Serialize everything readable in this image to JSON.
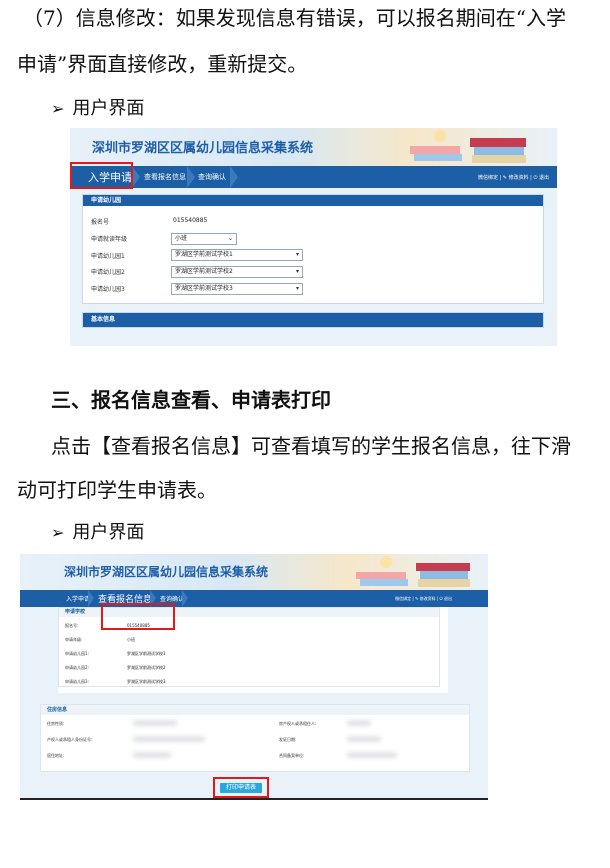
{
  "doc": {
    "item7": "（7）信息修改：如果发现信息有错误，可以报名期间在“入学",
    "item7_cont": "申请”界面直接修改，重新提交。",
    "bullet_label": "用户界面",
    "section3": "三、报名信息查看、申请表打印",
    "para1": "点击【查看报名信息】可查看填写的学生报名信息，往下滑",
    "para1_cont": "动可打印学生申请表。",
    "bullet_label2": "用户界面"
  },
  "shot1": {
    "system_title": "深圳市罗湖区区属幼儿园信息采集系统",
    "nav": {
      "tab1": "入学申请",
      "tab2": "查看报名信息",
      "tab3": "查询确认",
      "right": "微信绑定 | ✎ 修改资料 | ⏻ 退出"
    },
    "panel1_title": "申请幼儿园",
    "fields": [
      {
        "label": "报名号",
        "value": "015540885"
      },
      {
        "label": "申请就读年级",
        "value": "小班"
      },
      {
        "label": "申请幼儿园1",
        "value": "罗湖区学前测试学校1"
      },
      {
        "label": "申请幼儿园2",
        "value": "罗湖区学前测试学校2"
      },
      {
        "label": "申请幼儿园3",
        "value": "罗湖区学前测试学校3"
      }
    ],
    "panel2_title": "基本信息"
  },
  "shot2": {
    "system_title": "深圳市罗湖区区属幼儿园信息采集系统",
    "nav": {
      "tab1": "入学申请",
      "tab2": "查看报名信息",
      "tab3": "查询确认",
      "right": "微信绑定 | ✎ 修改资料 | ⏻ 退出"
    },
    "panel1_title": "申请学校",
    "fields": [
      {
        "label": "报名号:",
        "value": "015540885"
      },
      {
        "label": "申请年级:",
        "value": "小班"
      },
      {
        "label": "申请幼儿园1:",
        "value": "罗湖区学前测试学校1"
      },
      {
        "label": "申请幼儿园2:",
        "value": "罗湖区学前测试学校2"
      },
      {
        "label": "申请幼儿园3:",
        "value": "罗湖区学前测试学校3"
      }
    ],
    "panel2_title": "住房信息",
    "housing_left": [
      "住房性质:",
      "产权人或承租人身份证号:",
      "居住地址:"
    ],
    "housing_right": [
      "房产权人或承租住人:",
      "发证日期:",
      "合同备案单位:"
    ],
    "print_button": "打印申请表"
  }
}
